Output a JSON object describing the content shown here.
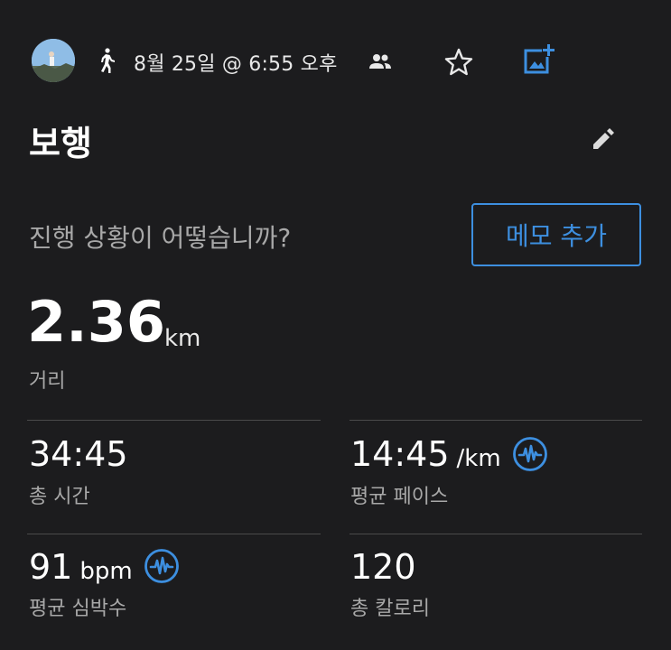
{
  "header": {
    "date_time": "8월 25일 @ 6:55 오후",
    "icons": [
      "avatar",
      "walk-icon",
      "people-icon",
      "star-icon",
      "add-photo-icon"
    ]
  },
  "activity": {
    "title": "보행",
    "prompt": "진행 상황이 어떻습니까?",
    "memo_button_label": "메모 추가"
  },
  "distance": {
    "value": "2.36",
    "unit": "km",
    "label": "거리"
  },
  "stats": {
    "total_time": {
      "value": "34:45",
      "unit": "",
      "label": "총 시간"
    },
    "avg_pace": {
      "value": "14:45",
      "unit": "/km",
      "label": "평균 페이스"
    },
    "avg_hr": {
      "value": "91",
      "unit": "bpm",
      "label": "평균 심박수"
    },
    "calories": {
      "value": "120",
      "unit": "",
      "label": "총 칼로리"
    }
  },
  "colors": {
    "background": "#1c1c1e",
    "accent": "#3d8fe0",
    "label": "#a8a8a8",
    "divider": "#4a4a4a"
  }
}
